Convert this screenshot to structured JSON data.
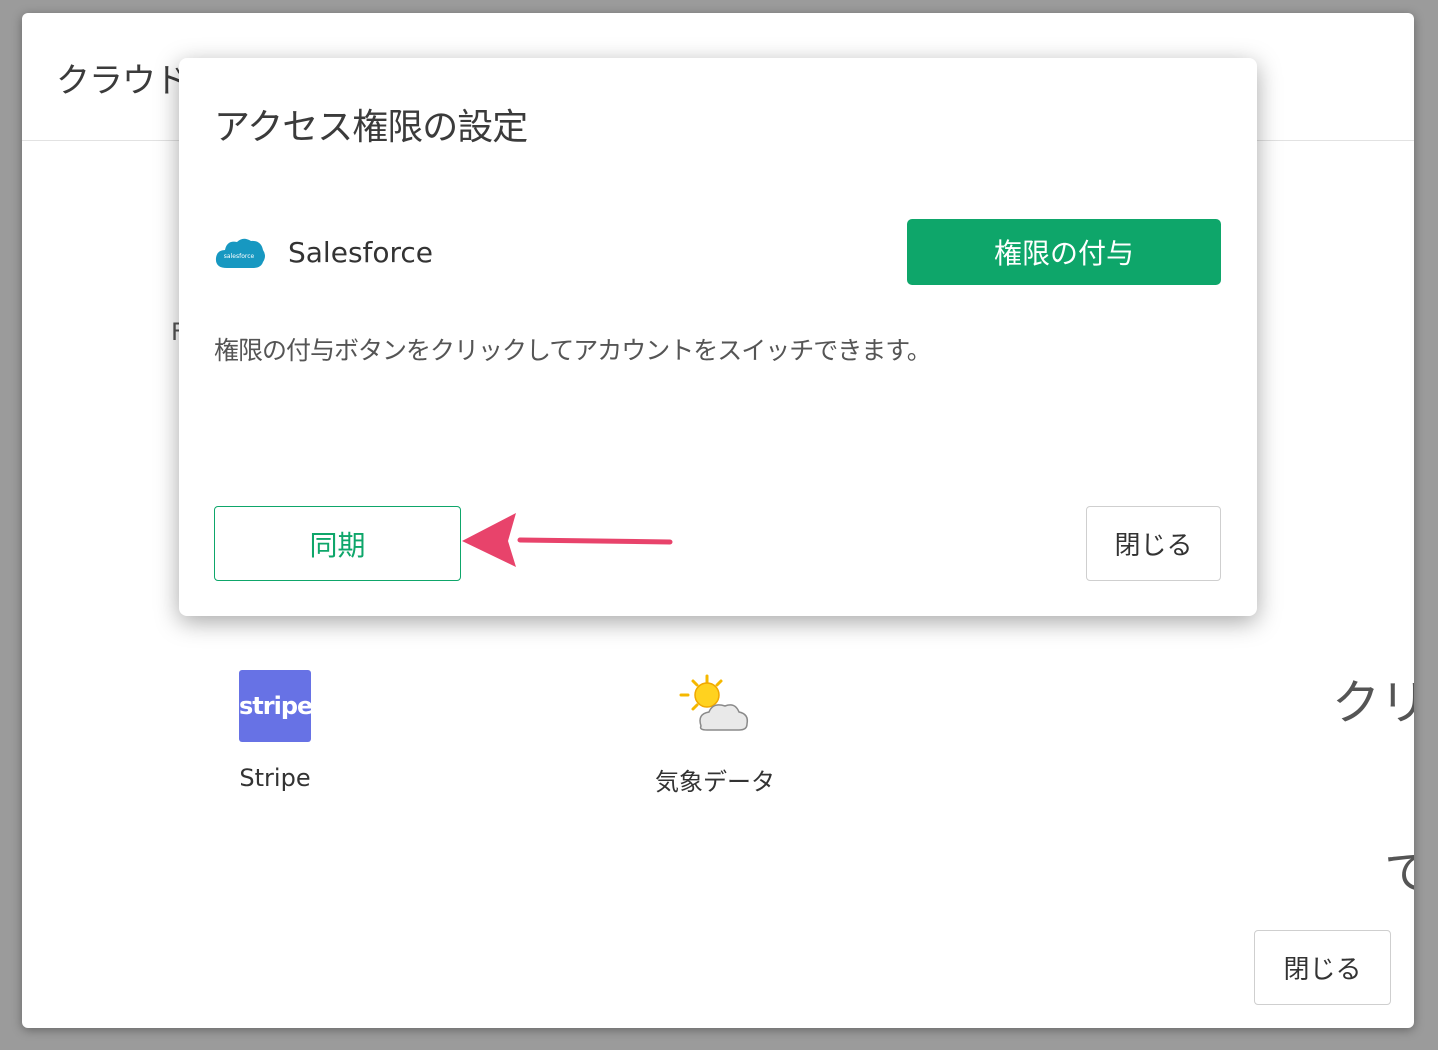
{
  "outer_dialog": {
    "title": "クラウドアプリケーションデータ",
    "partial_letter": "F",
    "edge_text_1": "クリ",
    "edge_text_2": "て",
    "close_label": "閉じる",
    "services": [
      {
        "label": "Stripe",
        "logo_text": "stripe",
        "brand_color": "#6772e5",
        "icon": "stripe-logo"
      },
      {
        "label": "気象データ",
        "icon": "weather-sun-cloud-icon"
      }
    ]
  },
  "modal": {
    "title": "アクセス権限の設定",
    "provider": {
      "name": "Salesforce",
      "logo_text": "salesforce",
      "icon": "salesforce-cloud-logo",
      "brand_color": "#1798c1"
    },
    "grant_label": "権限の付与",
    "description": "権限の付与ボタンをクリックしてアカウントをスイッチできます。",
    "sync_label": "同期",
    "close_label": "閉じる"
  },
  "colors": {
    "accent_green": "#0ea66a",
    "annotation_arrow": "#e8436b"
  }
}
